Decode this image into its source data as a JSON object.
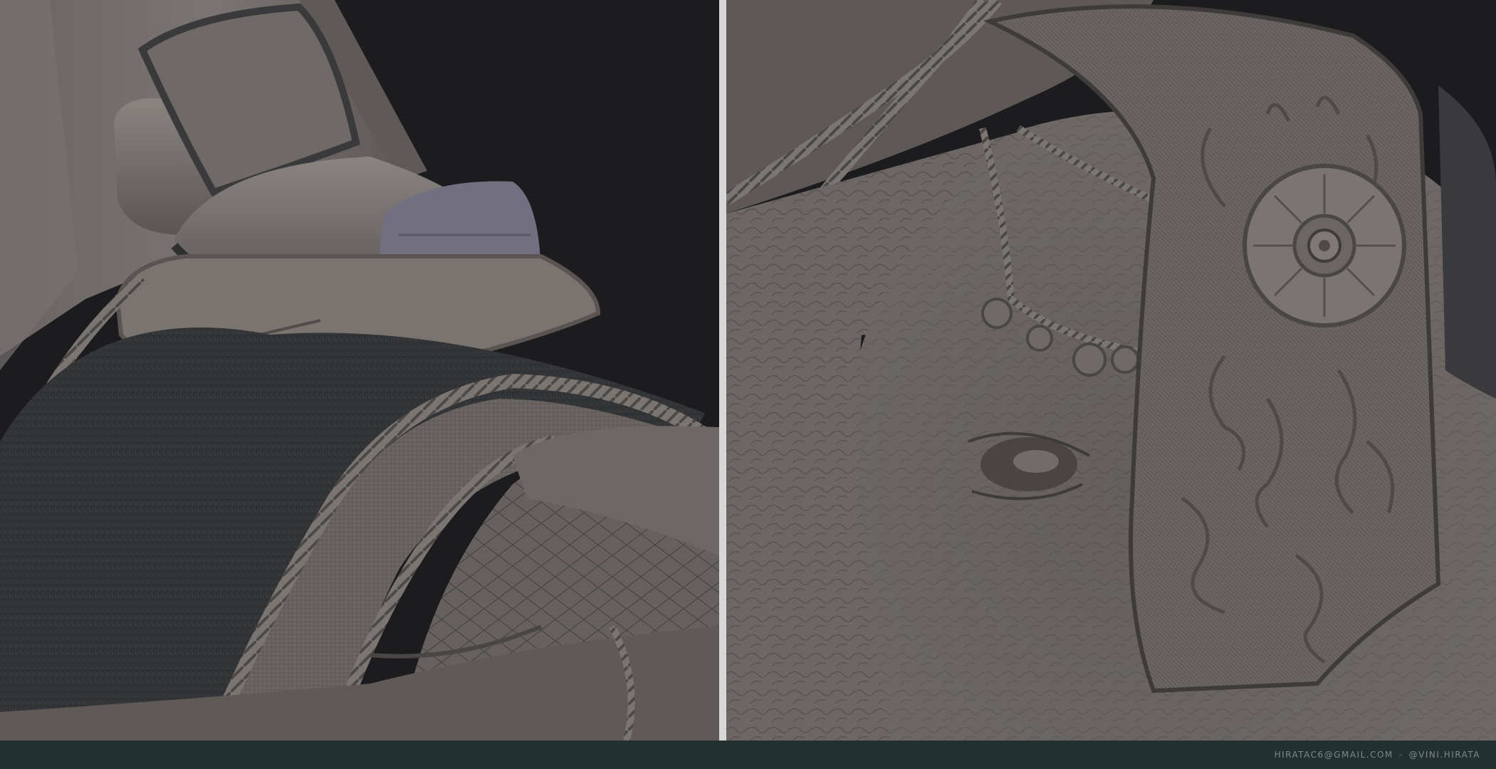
{
  "footer": {
    "email": "HIRATAC6@GMAIL.COM",
    "separator": "-",
    "handle": "@VINI.HIRATA"
  },
  "colors": {
    "background": "#1c1c1e",
    "clay": "#6e6866",
    "fur": "#2e3032",
    "footer_bar": "#22302f",
    "divider": "#d8d8d8"
  },
  "panels": [
    {
      "subject": "elephant saddle with pillows, fur blanket and rope trim"
    },
    {
      "subject": "elephant head with ornate ear cloth and rosette medallion"
    }
  ]
}
